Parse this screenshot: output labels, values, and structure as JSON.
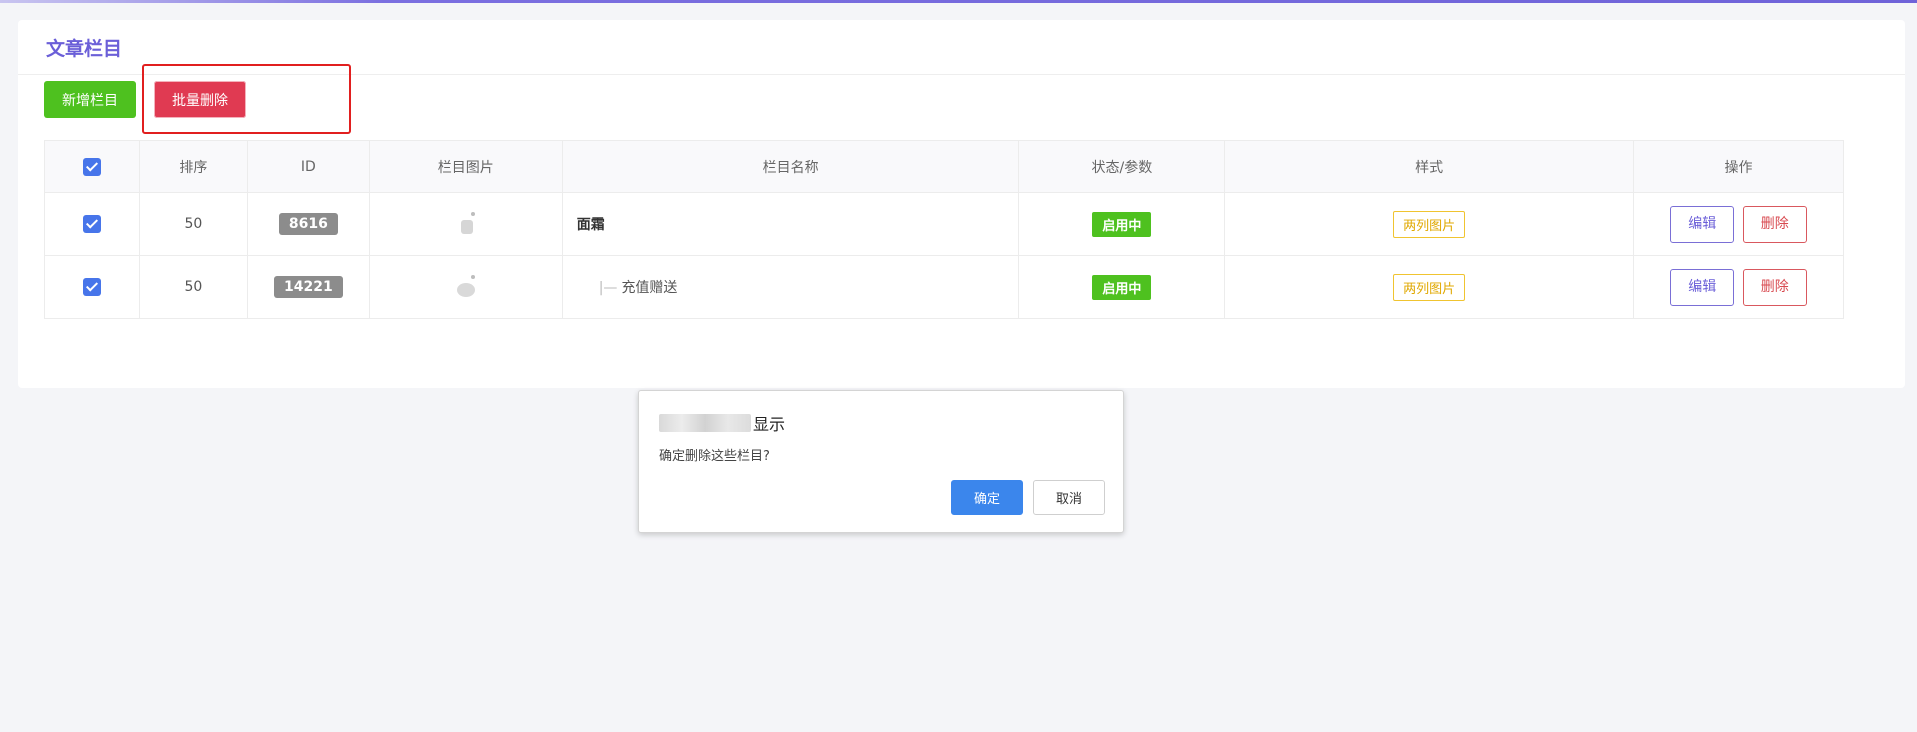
{
  "page": {
    "title": "文章栏目"
  },
  "toolbar": {
    "add_label": "新增栏目",
    "batch_delete_label": "批量删除"
  },
  "table": {
    "headers": [
      "排序",
      "ID",
      "栏目图片",
      "栏目名称",
      "状态/参数",
      "样式",
      "操作"
    ],
    "rows": [
      {
        "checked": true,
        "sort": "50",
        "id": "8616",
        "name": "面霜",
        "is_child": false,
        "status": "启用中",
        "style": "两列图片",
        "edit_label": "编辑",
        "delete_label": "删除"
      },
      {
        "checked": true,
        "sort": "50",
        "id": "14221",
        "name": "充值赠送",
        "is_child": true,
        "status": "启用中",
        "style": "两列图片",
        "edit_label": "编辑",
        "delete_label": "删除"
      }
    ]
  },
  "dialog": {
    "heading": "显示",
    "message": "确定删除这些栏目?",
    "ok_label": "确定",
    "cancel_label": "取消"
  },
  "colors": {
    "accent": "#6b5fd8",
    "success": "#4ec11f",
    "danger": "#e03a52",
    "checkbox": "#4775ea",
    "dialog_ok": "#3b86ec",
    "highlight": "#e11f1f"
  }
}
